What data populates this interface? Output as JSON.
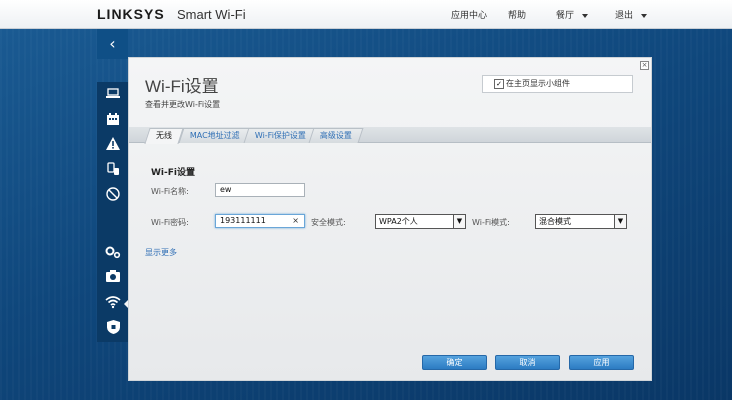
{
  "header": {
    "brand": "LINKSYS",
    "product": "Smart Wi-Fi",
    "nav": {
      "app_center": "应用中心",
      "help": "帮助",
      "account": "餐厅",
      "logout": "退出"
    }
  },
  "panel": {
    "title": "Wi-Fi设置",
    "subtitle": "查看并更改Wi-Fi设置",
    "widget_label": "在主页显示小组件",
    "widget_checked": true,
    "tabs": [
      {
        "label": "无线",
        "active": true
      },
      {
        "label": "MAC地址过滤",
        "active": false
      },
      {
        "label": "Wi-Fi保护设置",
        "active": false
      },
      {
        "label": "高级设置",
        "active": false
      }
    ],
    "section_title": "Wi-Fi设置",
    "fields": {
      "name_label": "Wi-Fi名称:",
      "name_value": "ew",
      "password_label": "Wi-Fi密码:",
      "password_value": "193111111",
      "security_label": "安全模式:",
      "security_value": "WPA2个人",
      "mode_label": "Wi-Fi模式:",
      "mode_value": "混合模式"
    },
    "show_more": "显示更多",
    "buttons": {
      "ok": "确定",
      "cancel": "取消",
      "apply": "应用"
    }
  },
  "icons": {
    "back": "‹",
    "close": "×",
    "clear": "×",
    "check": "✓",
    "dropdown": "▼"
  }
}
